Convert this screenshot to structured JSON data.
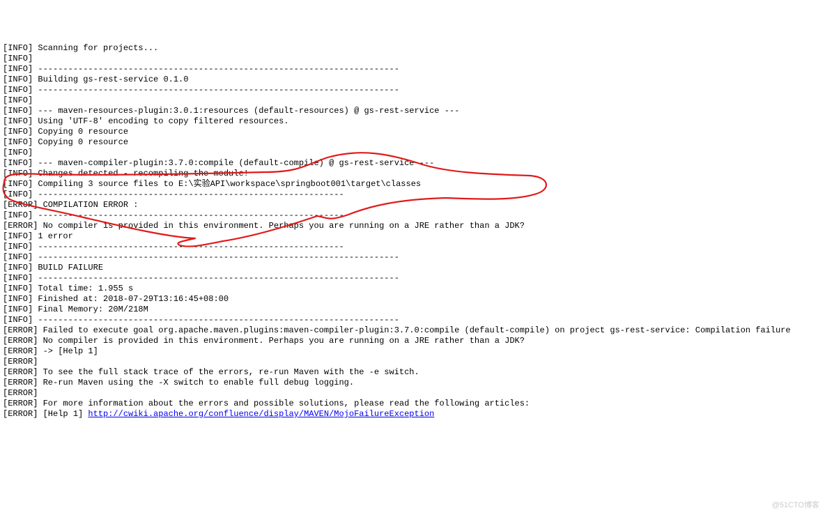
{
  "lines": [
    "[INFO] Scanning for projects...",
    "[INFO]",
    "[INFO] ------------------------------------------------------------------------",
    "[INFO] Building gs-rest-service 0.1.0",
    "[INFO] ------------------------------------------------------------------------",
    "[INFO]",
    "[INFO] --- maven-resources-plugin:3.0.1:resources (default-resources) @ gs-rest-service ---",
    "[INFO] Using 'UTF-8' encoding to copy filtered resources.",
    "[INFO] Copying 0 resource",
    "[INFO] Copying 0 resource",
    "[INFO]",
    "[INFO] --- maven-compiler-plugin:3.7.0:compile (default-compile) @ gs-rest-service ---",
    "[INFO] Changes detected - recompiling the module!",
    "[INFO] Compiling 3 source files to E:\\实验API\\workspace\\springboot001\\target\\classes",
    "[INFO] -------------------------------------------------------------",
    "[ERROR] COMPILATION ERROR :",
    "[INFO] -------------------------------------------------------------",
    "[ERROR] No compiler is provided in this environment. Perhaps you are running on a JRE rather than a JDK?",
    "[INFO] 1 error",
    "[INFO] -------------------------------------------------------------",
    "[INFO] ------------------------------------------------------------------------",
    "[INFO] BUILD FAILURE",
    "[INFO] ------------------------------------------------------------------------",
    "[INFO] Total time: 1.955 s",
    "[INFO] Finished at: 2018-07-29T13:16:45+08:00",
    "[INFO] Final Memory: 20M/218M",
    "[INFO] ------------------------------------------------------------------------",
    "[ERROR] Failed to execute goal org.apache.maven.plugins:maven-compiler-plugin:3.7.0:compile (default-compile) on project gs-rest-service: Compilation failure",
    "[ERROR] No compiler is provided in this environment. Perhaps you are running on a JRE rather than a JDK?",
    "[ERROR] -> [Help 1]",
    "[ERROR]",
    "[ERROR] To see the full stack trace of the errors, re-run Maven with the -e switch.",
    "[ERROR] Re-run Maven using the -X switch to enable full debug logging.",
    "[ERROR]",
    "[ERROR] For more information about the errors and possible solutions, please read the following articles:"
  ],
  "last_line_prefix": "[ERROR] [Help 1] ",
  "help_url": "http://cwiki.apache.org/confluence/display/MAVEN/MojoFailureException",
  "watermark": "@51CTO博客"
}
